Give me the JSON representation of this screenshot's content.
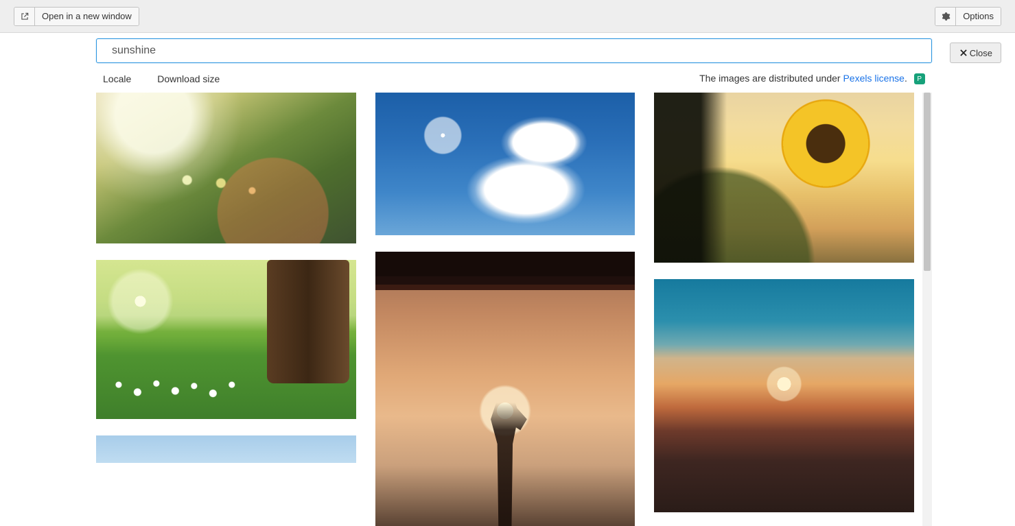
{
  "toolbar": {
    "open_new_window_label": "Open in a new window",
    "options_label": "Options"
  },
  "search": {
    "value": "sunshine"
  },
  "filters": {
    "locale_label": "Locale",
    "download_size_label": "Download size"
  },
  "license": {
    "prefix": "The images are distributed under ",
    "link_text": "Pexels license",
    "suffix": "."
  },
  "close_label": "Close",
  "results": {
    "col1": [
      {
        "name": "yellow-flowers-bokeh-sunlight"
      },
      {
        "name": "sun-through-tree-green-meadow-white-flowers"
      },
      {
        "name": "blue-sky-strip"
      }
    ],
    "col2": [
      {
        "name": "blue-sky-sun-clouds"
      },
      {
        "name": "hand-silhouette-holding-sun-sunset"
      }
    ],
    "col3": [
      {
        "name": "sunflower-at-sunset"
      },
      {
        "name": "beach-ocean-sunset-bokeh"
      }
    ]
  }
}
